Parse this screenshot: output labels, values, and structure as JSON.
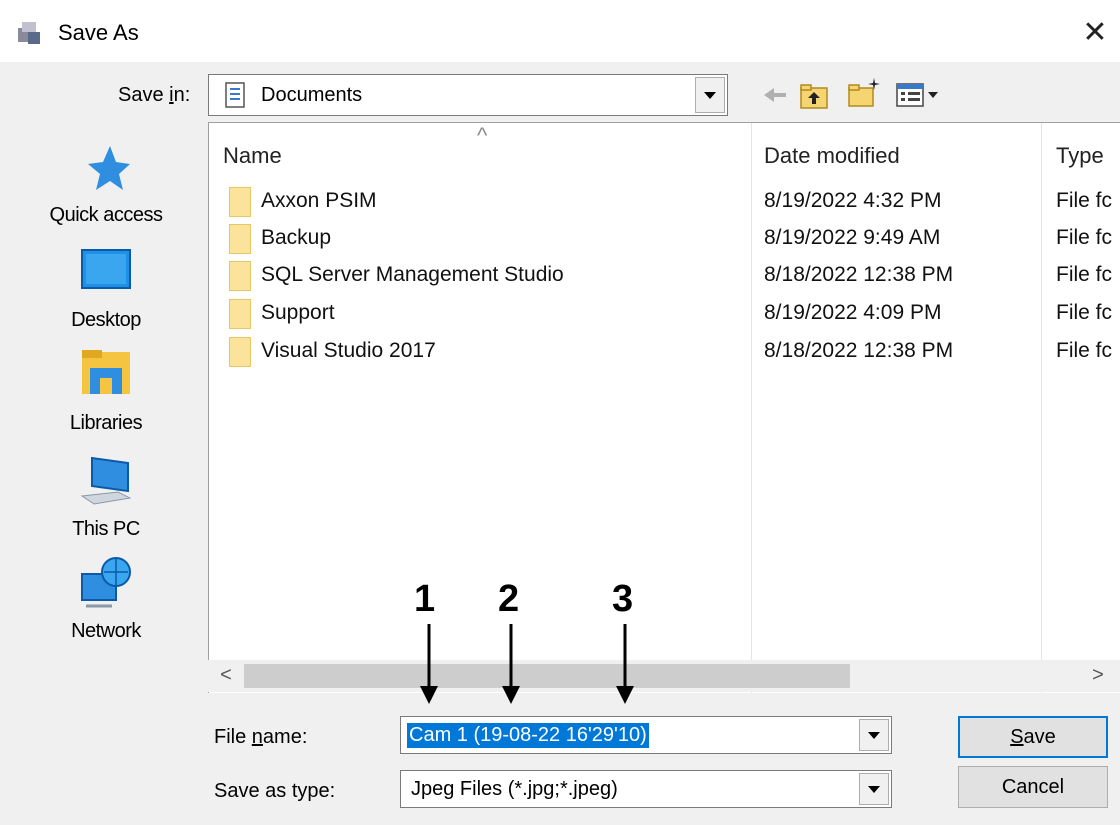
{
  "window": {
    "title": "Save As",
    "close_glyph": "✕"
  },
  "save_in": {
    "label_pre": "Save ",
    "label_key": "i",
    "label_post": "n:",
    "value": "Documents"
  },
  "toolbar": {
    "icons": [
      "back-arrow-icon",
      "up-folder-icon",
      "new-folder-icon",
      "view-menu-icon"
    ]
  },
  "places": [
    {
      "label": "Quick access",
      "icon": "star-icon"
    },
    {
      "label": "Desktop",
      "icon": "desktop-icon"
    },
    {
      "label": "Libraries",
      "icon": "libraries-icon"
    },
    {
      "label": "This PC",
      "icon": "computer-icon"
    },
    {
      "label": "Network",
      "icon": "network-icon"
    }
  ],
  "file_list": {
    "columns": [
      "Name",
      "Date modified",
      "Type"
    ],
    "sort_glyph": "^",
    "rows": [
      {
        "name": "Axxon PSIM",
        "date": "8/19/2022 4:32 PM",
        "type": "File fc"
      },
      {
        "name": "Backup",
        "date": "8/19/2022 9:49 AM",
        "type": "File fc"
      },
      {
        "name": "SQL Server Management Studio",
        "date": "8/18/2022 12:38 PM",
        "type": "File fc"
      },
      {
        "name": "Support",
        "date": "8/19/2022 4:09 PM",
        "type": "File fc"
      },
      {
        "name": "Visual Studio 2017",
        "date": "8/18/2022 12:38 PM",
        "type": "File fc"
      }
    ]
  },
  "scrollbar": {
    "left_glyph": "<",
    "right_glyph": ">"
  },
  "file_name": {
    "label_pre": "File ",
    "label_key": "n",
    "label_post": "ame:",
    "value": "Cam 1 (19-08-22 16'29'10)"
  },
  "save_as_type": {
    "label": "Save as type:",
    "value": "Jpeg Files (*.jpg;*.jpeg)"
  },
  "buttons": {
    "save_key": "S",
    "save_rest": "ave",
    "cancel": "Cancel"
  },
  "annotations": [
    "1",
    "2",
    "3"
  ],
  "colors": {
    "selection": "#0078d7",
    "folder": "#fbe39b",
    "dialog_bg": "#f0f0f0"
  }
}
